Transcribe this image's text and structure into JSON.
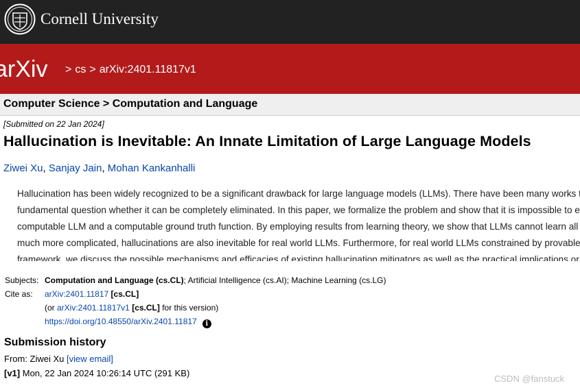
{
  "cornell": {
    "name": "Cornell University"
  },
  "arxiv": {
    "logo_text": "arXiv",
    "crumbs": {
      "sep": ">",
      "category": "cs",
      "paper_id": "arXiv:2401.11817v1"
    }
  },
  "subheader": {
    "text": "Computer Science > Computation and Language"
  },
  "paper": {
    "dateline": "[Submitted on 22 Jan 2024]",
    "title": "Hallucination is Inevitable: An Innate Limitation of Large Language Models",
    "authors": [
      "Ziwei Xu",
      "Sanjay Jain",
      "Mohan Kankanhalli"
    ],
    "author_sep": ", ",
    "abstract_lines": [
      "Hallucination has been widely recognized to be a significant drawback for large language models (LLMs). There have been many works t",
      "fundamental question whether it can be completely eliminated. In this paper, we formalize the problem and show that it is impossible to e",
      "computable LLM and a computable ground truth function. By employing results from learning theory, we show that LLMs cannot learn all",
      "much more complicated, hallucinations are also inevitable for real world LLMs. Furthermore, for real world LLMs constrained by provable",
      "framework, we discuss the possible mechanisms and efficacies of existing hallucination mitigators as well as the practical implications or"
    ]
  },
  "meta": {
    "subjects_label": "Subjects:",
    "subjects_primary": "Computation and Language (cs.CL)",
    "subjects_rest": "; Artificial Intelligence (cs.AI); Machine Learning (cs.LG)",
    "cite_label": "Cite as:",
    "cite_id": "arXiv:2401.11817",
    "cite_cat": "[cs.CL]",
    "or_prefix": "(or ",
    "version_id": "arXiv:2401.11817v1",
    "version_cat": "[cs.CL]",
    "version_suffix": " for this version)",
    "doi": "https://doi.org/10.48550/arXiv.2401.11817",
    "info_icon": "i"
  },
  "history": {
    "title": "Submission history",
    "from_label": "From: Ziwei Xu ",
    "view_email": "[view email]",
    "v1_tag": "[v1]",
    "v1_text": " Mon, 22 Jan 2024 10:26:14 UTC (291 KB)"
  },
  "watermark": "CSDN @fanstuck",
  "colors": {
    "cornell_bar": "#222222",
    "arxiv_red": "#b31b1b",
    "link": "#0645ad"
  }
}
